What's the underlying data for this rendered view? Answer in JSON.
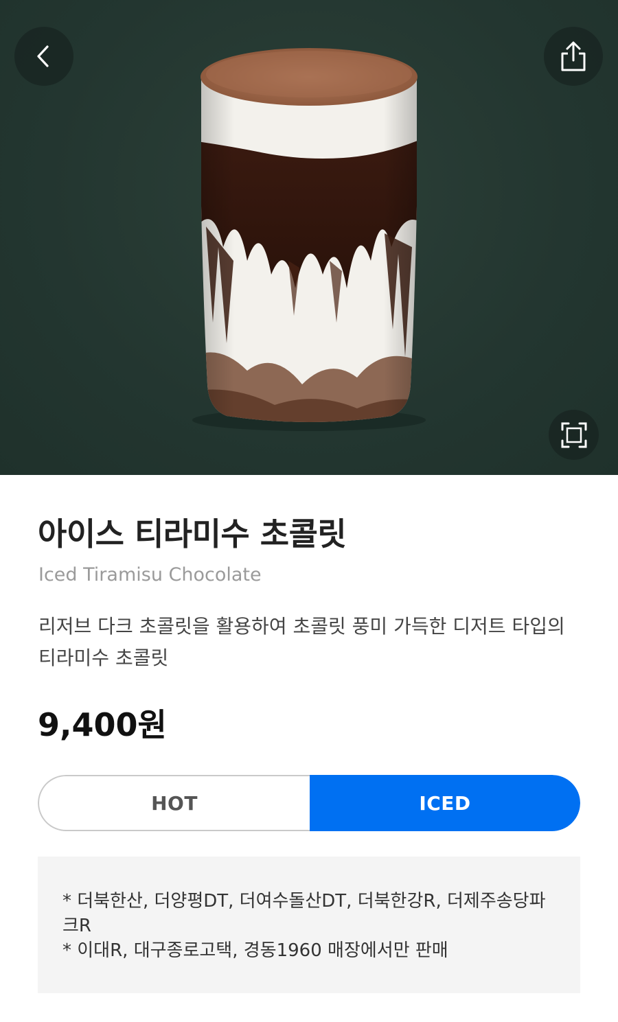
{
  "product": {
    "name_ko": "아이스 티라미수 초콜릿",
    "name_en": "Iced Tiramisu Chocolate",
    "description": "리저브 다크 초콜릿을 활용하여 초콜릿 풍미 가득한 디저트 타입의 티라미수 초콜릿",
    "price": "9,400원"
  },
  "temperature": {
    "options": [
      "HOT",
      "ICED"
    ],
    "selected": "ICED"
  },
  "notice": {
    "lines": [
      "* 더북한산, 더양평DT, 더여수돌산DT, 더북한강R, 더제주송당파크R",
      "* 이대R, 대구종로고택, 경동1960 매장에서만 판매"
    ]
  },
  "icons": {
    "back": "chevron-left-icon",
    "share": "share-icon",
    "zoom": "fullscreen-icon"
  },
  "colors": {
    "hero_bg": "#233630",
    "accent": "#0070f2",
    "notice_bg": "#f4f4f4"
  }
}
